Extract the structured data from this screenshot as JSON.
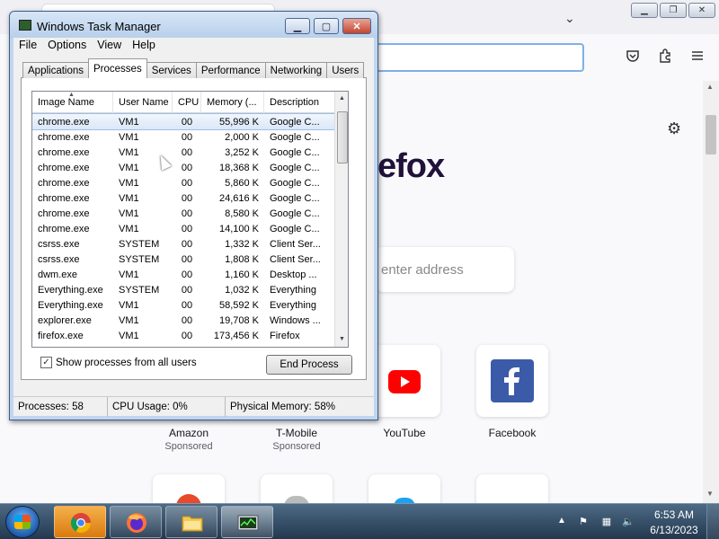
{
  "firefox": {
    "logo_text": "efox",
    "search_placeholder": "enter address",
    "shortcuts": [
      {
        "label": "Amazon",
        "sub": "Sponsored"
      },
      {
        "label": "T-Mobile",
        "sub": "Sponsored"
      },
      {
        "label": "YouTube",
        "sub": ""
      },
      {
        "label": "Facebook",
        "sub": ""
      }
    ]
  },
  "taskmanager": {
    "title": "Windows Task Manager",
    "menu": [
      "File",
      "Options",
      "View",
      "Help"
    ],
    "tabs": [
      "Applications",
      "Processes",
      "Services",
      "Performance",
      "Networking",
      "Users"
    ],
    "active_tab": "Processes",
    "columns": [
      "Image Name",
      "User Name",
      "CPU",
      "Memory (...",
      "Description"
    ],
    "processes": [
      {
        "name": "chrome.exe",
        "user": "VM1",
        "cpu": "00",
        "mem": "55,996 K",
        "desc": "Google C..."
      },
      {
        "name": "chrome.exe",
        "user": "VM1",
        "cpu": "00",
        "mem": "2,000 K",
        "desc": "Google C..."
      },
      {
        "name": "chrome.exe",
        "user": "VM1",
        "cpu": "00",
        "mem": "3,252 K",
        "desc": "Google C..."
      },
      {
        "name": "chrome.exe",
        "user": "VM1",
        "cpu": "00",
        "mem": "18,368 K",
        "desc": "Google C..."
      },
      {
        "name": "chrome.exe",
        "user": "VM1",
        "cpu": "00",
        "mem": "5,860 K",
        "desc": "Google C..."
      },
      {
        "name": "chrome.exe",
        "user": "VM1",
        "cpu": "00",
        "mem": "24,616 K",
        "desc": "Google C..."
      },
      {
        "name": "chrome.exe",
        "user": "VM1",
        "cpu": "00",
        "mem": "8,580 K",
        "desc": "Google C..."
      },
      {
        "name": "chrome.exe",
        "user": "VM1",
        "cpu": "00",
        "mem": "14,100 K",
        "desc": "Google C..."
      },
      {
        "name": "csrss.exe",
        "user": "SYSTEM",
        "cpu": "00",
        "mem": "1,332 K",
        "desc": "Client Ser..."
      },
      {
        "name": "csrss.exe",
        "user": "SYSTEM",
        "cpu": "00",
        "mem": "1,808 K",
        "desc": "Client Ser..."
      },
      {
        "name": "dwm.exe",
        "user": "VM1",
        "cpu": "00",
        "mem": "1,160 K",
        "desc": "Desktop ..."
      },
      {
        "name": "Everything.exe",
        "user": "SYSTEM",
        "cpu": "00",
        "mem": "1,032 K",
        "desc": "Everything"
      },
      {
        "name": "Everything.exe",
        "user": "VM1",
        "cpu": "00",
        "mem": "58,592 K",
        "desc": "Everything"
      },
      {
        "name": "explorer.exe",
        "user": "VM1",
        "cpu": "00",
        "mem": "19,708 K",
        "desc": "Windows ..."
      },
      {
        "name": "firefox.exe",
        "user": "VM1",
        "cpu": "00",
        "mem": "173,456 K",
        "desc": "Firefox"
      }
    ],
    "selected_index": 0,
    "show_all_label": "Show processes from all users",
    "show_all_checked": "✓",
    "end_process_label": "End Process",
    "status": {
      "processes": "Processes: 58",
      "cpu": "CPU Usage: 0%",
      "memory": "Physical Memory: 58%"
    }
  },
  "taskbar": {
    "clock_time": "6:53 AM",
    "clock_date": "6/13/2023"
  },
  "colors": {
    "firefox_logo": "#20123a",
    "youtube_red": "#ff0000",
    "facebook_blue": "#1877f2",
    "selection": "#dbe7f8"
  }
}
